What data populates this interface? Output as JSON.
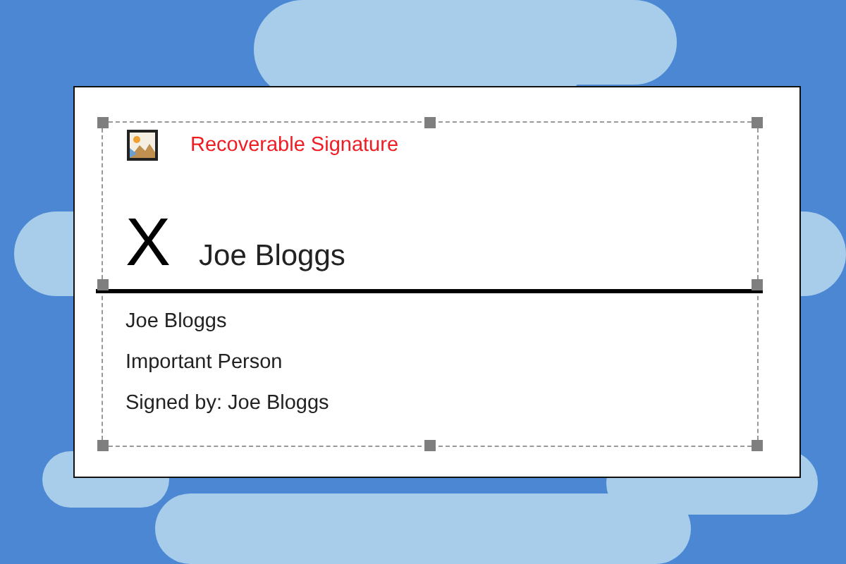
{
  "signature_line": {
    "selected": true,
    "status": "Recoverable Signature",
    "mark": "X",
    "signature": "Joe Bloggs",
    "signer_name": "Joe Bloggs",
    "signer_title": "Important Person",
    "signed_by": "Signed by: Joe Bloggs"
  }
}
